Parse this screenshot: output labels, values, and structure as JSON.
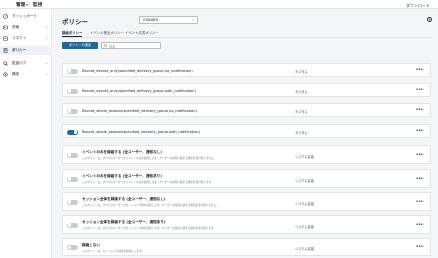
{
  "topbar": {
    "tabs": [
      {
        "label": "管理",
        "active": true
      },
      {
        "label": "監視",
        "active": false
      }
    ],
    "separator": "|",
    "download_label": "ダウンロード"
  },
  "sidebar": {
    "items": [
      {
        "label": "ダッシュボード",
        "icon": "dashboard-icon",
        "active": false,
        "expandable": false
      },
      {
        "label": "資格",
        "icon": "badge-icon",
        "active": false,
        "expandable": true
      },
      {
        "label": "コネクト",
        "icon": "connect-icon",
        "active": false,
        "expandable": true
      },
      {
        "label": "ポリシー",
        "icon": "policy-icon",
        "active": true,
        "expandable": false
      },
      {
        "label": "監査ログ",
        "icon": "audit-icon",
        "active": false,
        "expandable": true
      },
      {
        "label": "構成",
        "icon": "settings-icon",
        "active": false,
        "expandable": true
      }
    ]
  },
  "main": {
    "title": "ポリシー",
    "selector_value": "STANDHI",
    "subtabs": [
      {
        "label": "録画ポリシー",
        "active": true
      },
      {
        "label": "イベント検出ポリシー",
        "active": false
      },
      {
        "label": "イベント応答ポリシー",
        "active": false
      }
    ],
    "add_button_label": "ポリシーの追加",
    "search_placeholder": "検索",
    "policies": [
      {
        "name": "Record_events_only(specified_delivery_group,no_notification)",
        "type": "カスタム",
        "enabled": false,
        "bold": false,
        "description": ""
      },
      {
        "name": "Record_events_only(specified_delivery_group,with_notification)",
        "type": "カスタム",
        "enabled": false,
        "bold": false,
        "description": ""
      },
      {
        "name": "Record_whole_session(specified_delivery_group,no_notification)",
        "type": "カスタム",
        "enabled": false,
        "bold": false,
        "description": ""
      },
      {
        "name": "Record_whole_session(specified_delivery_group,with_notification)",
        "type": "カスタム",
        "enabled": true,
        "bold": false,
        "description": ""
      },
      {
        "name": "イベントのみを録画する (全ユーザー、通知なし)",
        "type": "システム定義",
        "enabled": false,
        "bold": true,
        "description": "このポリシーは、すべてのユーザーのイベントのみを録画します。ユーザーは録画に関する通知を受け取りません。"
      },
      {
        "name": "イベントのみを録画する (全ユーザー、通知あり)",
        "type": "システム定義",
        "enabled": false,
        "bold": true,
        "description": "このポリシーは、すべてのユーザーのイベントのみを録画します。ユーザーは録画に関する通知を受け取ります。"
      },
      {
        "name": "セッション全体を録画する (全ユーザー、通知なし)",
        "type": "システム定義",
        "enabled": false,
        "bold": true,
        "description": "このポリシーは、すべてのユーザーのセッション全体を録画します。ユーザーは録画に関する通知を受け取りません。"
      },
      {
        "name": "セッション全体を録画する (全ユーザー、通知あり)",
        "type": "システム定義",
        "enabled": false,
        "bold": true,
        "description": "このポリシーは、すべてのユーザーのセッション全体を録画します。ユーザーは録画に関する通知を受け取ります。"
      },
      {
        "name": "録画しない",
        "type": "システム定義",
        "enabled": false,
        "bold": true,
        "description": "このポリシーは、セッションの録画を無効にします。"
      }
    ],
    "more_label": "•••"
  }
}
